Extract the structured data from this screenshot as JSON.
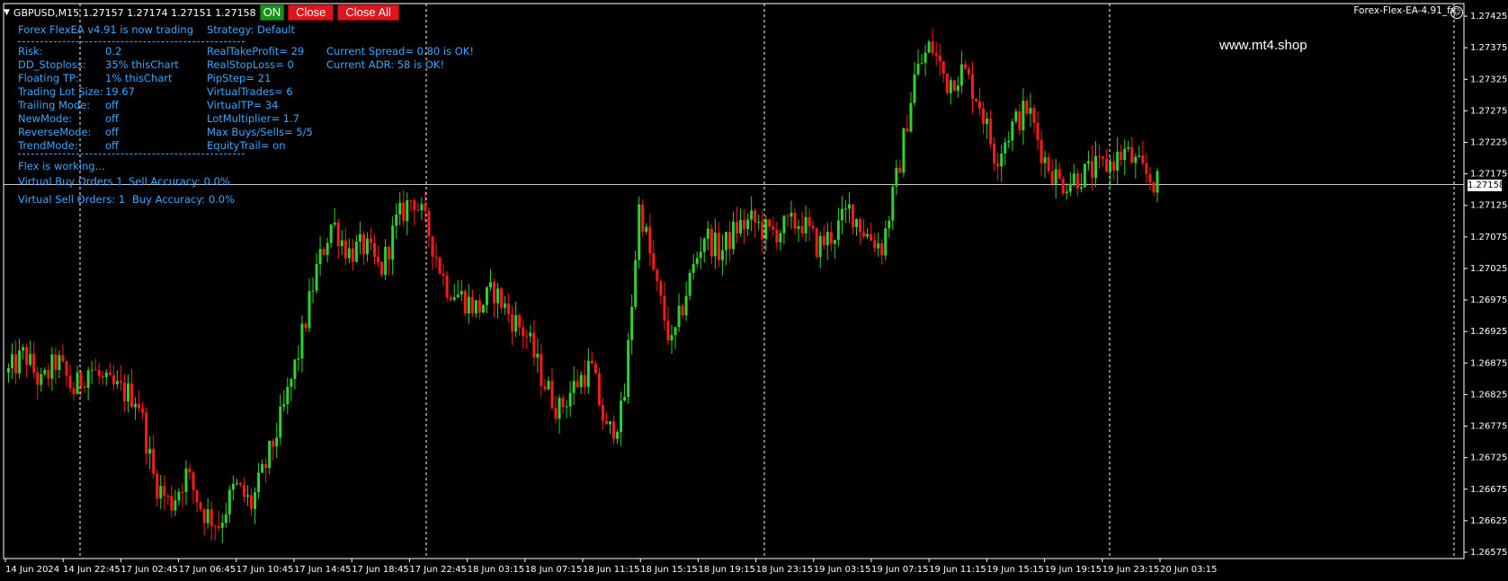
{
  "header": {
    "symbol": "GBPUSD,M15",
    "ohlc": "1.27157 1.27174 1.27151 1.27158",
    "on_label": "ON",
    "close_label": "Close",
    "close_all_label": "Close All",
    "ea_name": "Forex-Flex-EA-4.91_fx",
    "watermark": "www.mt4.shop"
  },
  "info_panel": {
    "title": "Forex FlexEA v4.91 is now trading",
    "strategy": "Strategy: Default",
    "left": [
      {
        "label": "Risk:",
        "value": "0.2"
      },
      {
        "label": "DD_Stoploss:",
        "value": "35%  thisChart"
      },
      {
        "label": "Floating TP:",
        "value": "1%  thisChart"
      },
      {
        "label": "Trading Lot Size:",
        "value": "19.67"
      },
      {
        "label": "Trailing Mode:",
        "value": "off"
      },
      {
        "label": "NewMode:",
        "value": "off"
      },
      {
        "label": "ReverseMode:",
        "value": "off"
      },
      {
        "label": "TrendMode:",
        "value": "off"
      }
    ],
    "middle": [
      "RealTakeProfit= 29",
      "RealStopLoss= 0",
      "PipStep= 21",
      "VirtualTrades= 6",
      "VirtualTP= 34",
      "LotMultiplier= 1.7",
      "Max Buys/Sells= 5/5",
      "EquityTrail= on"
    ],
    "right": [
      "Current Spread= 0.80 is OK!",
      "Current ADR: 58  is OK!"
    ],
    "status": "Flex is working...",
    "buy_orders": "Virtual Buy Orders 1",
    "sell_accuracy": "Sell Accuracy: 0.0%",
    "sell_orders": "Virtual Sell Orders: 1",
    "buy_accuracy": "Buy Accuracy: 0.0%"
  },
  "colors": {
    "bull": "#2fd12f",
    "bear": "#ff1a1a",
    "text": "#3aa7ff",
    "grid": "#ffffff"
  },
  "chart_data": {
    "type": "candlestick",
    "current_price": "1.27158",
    "ylim": [
      1.26565,
      1.27445
    ],
    "y_ticks": [
      "1.27425",
      "1.27375",
      "1.27325",
      "1.27275",
      "1.27225",
      "1.27175",
      "1.27125",
      "1.27075",
      "1.27025",
      "1.26975",
      "1.26925",
      "1.26875",
      "1.26825",
      "1.26775",
      "1.26725",
      "1.26675",
      "1.26625",
      "1.26575"
    ],
    "x_ticks": [
      "14 Jun 2024",
      "14 Jun 22:45",
      "17 Jun 02:45",
      "17 Jun 06:45",
      "17 Jun 10:45",
      "17 Jun 14:45",
      "17 Jun 18:45",
      "17 Jun 22:45",
      "18 Jun 03:15",
      "18 Jun 07:15",
      "18 Jun 11:15",
      "18 Jun 15:15",
      "18 Jun 19:15",
      "18 Jun 23:15",
      "19 Jun 03:15",
      "19 Jun 07:15",
      "19 Jun 11:15",
      "19 Jun 15:15",
      "19 Jun 19:15",
      "19 Jun 23:15",
      "20 Jun 03:15"
    ],
    "price_path": [
      [
        0,
        1.2686
      ],
      [
        3,
        1.2689
      ],
      [
        6,
        1.2684
      ],
      [
        9,
        1.2688
      ],
      [
        12,
        1.2683
      ],
      [
        15,
        1.2687
      ],
      [
        18,
        1.2684
      ],
      [
        21,
        1.2683
      ],
      [
        24,
        1.2682
      ],
      [
        27,
        1.2669
      ],
      [
        30,
        1.2665
      ],
      [
        33,
        1.267
      ],
      [
        36,
        1.2664
      ],
      [
        39,
        1.2662
      ],
      [
        42,
        1.2668
      ],
      [
        45,
        1.2665
      ],
      [
        48,
        1.2672
      ],
      [
        51,
        1.268
      ],
      [
        54,
        1.269
      ],
      [
        57,
        1.2702
      ],
      [
        60,
        1.271
      ],
      [
        63,
        1.2705
      ],
      [
        66,
        1.2706
      ],
      [
        69,
        1.2702
      ],
      [
        72,
        1.271
      ],
      [
        75,
        1.2714
      ],
      [
        78,
        1.2708
      ],
      [
        81,
        1.27
      ],
      [
        84,
        1.2698
      ],
      [
        87,
        1.2696
      ],
      [
        90,
        1.2699
      ],
      [
        93,
        1.2695
      ],
      [
        96,
        1.2692
      ],
      [
        99,
        1.2685
      ],
      [
        102,
        1.268
      ],
      [
        105,
        1.2684
      ],
      [
        108,
        1.2687
      ],
      [
        111,
        1.2676
      ],
      [
        114,
        1.268
      ],
      [
        117,
        1.2713
      ],
      [
        120,
        1.27
      ],
      [
        123,
        1.269
      ],
      [
        126,
        1.27
      ],
      [
        129,
        1.2708
      ],
      [
        132,
        1.2705
      ],
      [
        135,
        1.2709
      ],
      [
        138,
        1.271
      ],
      [
        141,
        1.2708
      ],
      [
        144,
        1.2709
      ],
      [
        147,
        1.271
      ],
      [
        150,
        1.2706
      ],
      [
        153,
        1.2708
      ],
      [
        156,
        1.2712
      ],
      [
        159,
        1.2708
      ],
      [
        162,
        1.2706
      ],
      [
        165,
        1.2718
      ],
      [
        168,
        1.2733
      ],
      [
        171,
        1.2738
      ],
      [
        174,
        1.2732
      ],
      [
        177,
        1.2734
      ],
      [
        180,
        1.2729
      ],
      [
        183,
        1.272
      ],
      [
        186,
        1.2725
      ],
      [
        189,
        1.2728
      ],
      [
        192,
        1.272
      ],
      [
        195,
        1.2716
      ],
      [
        198,
        1.2717
      ],
      [
        201,
        1.2718
      ],
      [
        204,
        1.2719
      ],
      [
        207,
        1.2721
      ],
      [
        210,
        1.2718
      ],
      [
        213,
        1.27158
      ]
    ]
  }
}
